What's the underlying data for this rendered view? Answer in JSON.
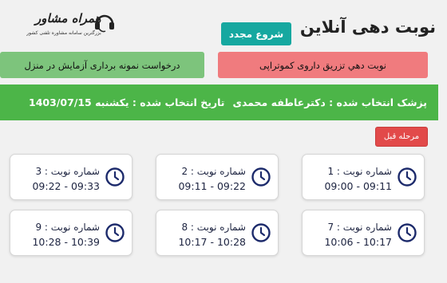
{
  "header": {
    "title": "نوبت دهی آنلاین",
    "restart_label": "شروع مجدد",
    "logo_text": "همراه مشاور",
    "logo_subtext": "بزرگترین سامانه مشاوره تلفنی کشور"
  },
  "services": {
    "chemo_label": "نوبت دهي تزريق داروی کموتراپی",
    "home_sampling_label": "درخواست نمونه برداری آزمايش در منزل"
  },
  "info": {
    "doctor": "پزشک انتخاب شده : دکترعاطفه محمدی",
    "date": "تاريخ انتخاب شده : يکشنبه 1403/07/15"
  },
  "prev_label": "مرحله قبل",
  "slots": [
    {
      "label": "شماره نوبت : 1",
      "time": "09:00 - 09:11"
    },
    {
      "label": "شماره نوبت : 2",
      "time": "09:11 - 09:22"
    },
    {
      "label": "شماره نوبت : 3",
      "time": "09:22 - 09:33"
    },
    {
      "label": "شماره نوبت : 7",
      "time": "10:06 - 10:17"
    },
    {
      "label": "شماره نوبت : 8",
      "time": "10:17 - 10:28"
    },
    {
      "label": "شماره نوبت : 9",
      "time": "10:28 - 10:39"
    }
  ],
  "colors": {
    "restart": "#16a8a0",
    "chemo": "#f07b7e",
    "home_sampling": "#7dc47c",
    "info_bar": "#4cb548",
    "prev": "#e24a4a",
    "clock": "#1c2a6b"
  }
}
